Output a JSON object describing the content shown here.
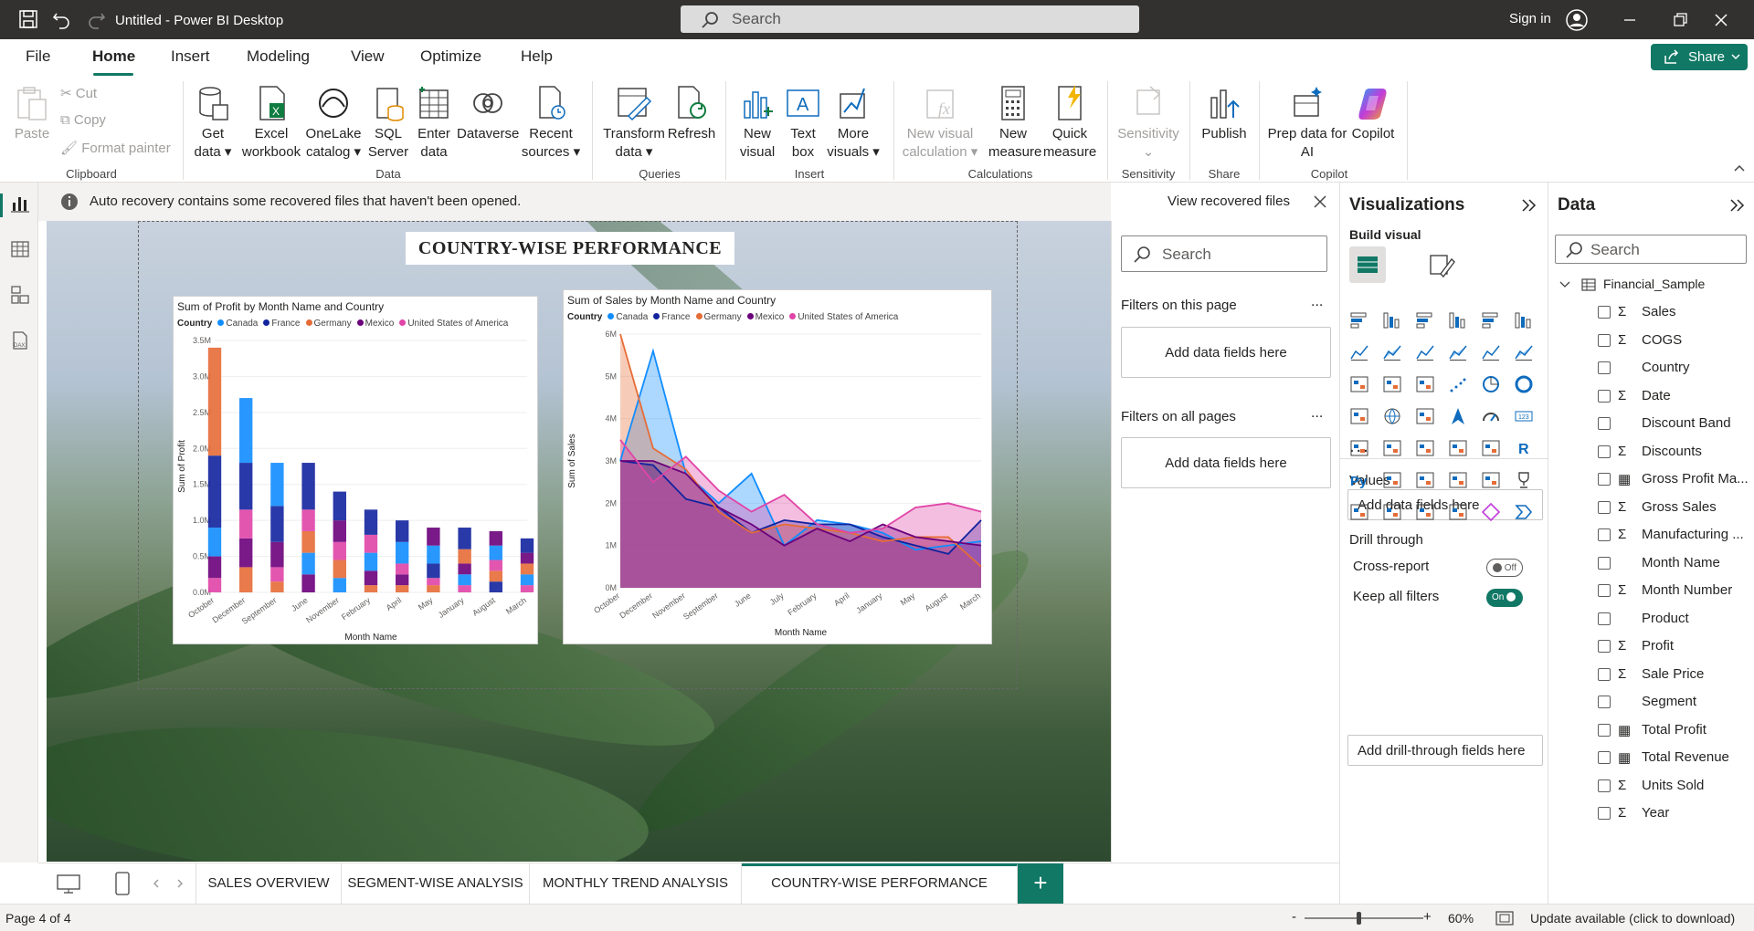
{
  "window": {
    "title": "Untitled - Power BI Desktop",
    "search_placeholder": "Search",
    "signin": "Sign in"
  },
  "menu": {
    "items": [
      "File",
      "Home",
      "Insert",
      "Modeling",
      "View",
      "Optimize",
      "Help"
    ],
    "active": "Home",
    "share": "Share"
  },
  "ribbon": {
    "clipboard": {
      "paste": "Paste",
      "cut": "Cut",
      "copy": "Copy",
      "format_painter": "Format painter",
      "group": "Clipboard"
    },
    "data": {
      "get_data": "Get data",
      "excel": "Excel workbook",
      "onelake": "OneLake catalog",
      "sql": "SQL Server",
      "enter": "Enter data",
      "dataverse": "Dataverse",
      "recent": "Recent sources",
      "group": "Data"
    },
    "queries": {
      "transform": "Transform data",
      "refresh": "Refresh",
      "group": "Queries"
    },
    "insert": {
      "new_visual": "New visual",
      "text_box": "Text box",
      "more": "More visuals",
      "group": "Insert"
    },
    "calculations": {
      "new_visual_calc": "New visual calculation",
      "new_measure": "New measure",
      "quick_measure": "Quick measure",
      "group": "Calculations"
    },
    "sensitivity": {
      "label": "Sensitivity",
      "group": "Sensitivity"
    },
    "share": {
      "publish": "Publish",
      "group": "Share"
    },
    "copilot": {
      "prep": "Prep data for AI",
      "copilot": "Copilot",
      "group": "Copilot"
    }
  },
  "notice": {
    "text": "Auto recovery contains some recovered files that haven't been opened.",
    "button": "View recovered files"
  },
  "report_title": "COUNTRY-WISE PERFORMANCE",
  "chart_data": [
    {
      "type": "area",
      "title": "Sum of Profit by Month Name and Country",
      "legend_title": "Country",
      "xlabel": "Month Name",
      "ylabel": "Sum of Profit",
      "ylim": [
        0,
        3500000
      ],
      "y_ticks": [
        "0.0M",
        "0.5M",
        "1.0M",
        "1.5M",
        "2.0M",
        "2.5M",
        "3.0M",
        "3.5M"
      ],
      "categories": [
        "October",
        "December",
        "September",
        "June",
        "November",
        "February",
        "April",
        "May",
        "January",
        "August",
        "March"
      ],
      "series": [
        {
          "name": "Canada",
          "color": "#118DFF",
          "values": [
            400000,
            900000,
            600000,
            300000,
            200000,
            250000,
            300000,
            250000,
            150000,
            200000,
            150000
          ]
        },
        {
          "name": "France",
          "color": "#12239E",
          "values": [
            1000000,
            650000,
            500000,
            650000,
            400000,
            350000,
            300000,
            200000,
            300000,
            150000,
            200000
          ]
        },
        {
          "name": "Germany",
          "color": "#E66C37",
          "values": [
            1500000,
            350000,
            150000,
            300000,
            250000,
            100000,
            100000,
            100000,
            200000,
            150000,
            150000
          ]
        },
        {
          "name": "Mexico",
          "color": "#6B007B",
          "values": [
            300000,
            400000,
            350000,
            250000,
            300000,
            200000,
            150000,
            250000,
            150000,
            200000,
            150000
          ]
        },
        {
          "name": "United States of America",
          "color": "#E044A7",
          "values": [
            200000,
            400000,
            200000,
            300000,
            250000,
            250000,
            150000,
            100000,
            100000,
            150000,
            100000
          ]
        }
      ]
    },
    {
      "type": "area",
      "title": "Sum of Sales by Month Name and Country",
      "legend_title": "Country",
      "xlabel": "Month Name",
      "ylabel": "Sum of Sales",
      "ylim": [
        0,
        6000000
      ],
      "y_ticks": [
        "0M",
        "1M",
        "2M",
        "3M",
        "4M",
        "5M",
        "6M"
      ],
      "categories": [
        "October",
        "December",
        "November",
        "September",
        "June",
        "July",
        "February",
        "April",
        "January",
        "May",
        "August",
        "March"
      ],
      "series": [
        {
          "name": "Canada",
          "color": "#118DFF",
          "values": [
            3000000,
            5600000,
            2700000,
            2000000,
            2700000,
            1000000,
            1600000,
            1500000,
            1300000,
            900000,
            1000000,
            1100000
          ]
        },
        {
          "name": "France",
          "color": "#12239E",
          "values": [
            3000000,
            2900000,
            2100000,
            1900000,
            1300000,
            1600000,
            1500000,
            1500000,
            1200000,
            1000000,
            800000,
            1600000
          ]
        },
        {
          "name": "Germany",
          "color": "#E66C37",
          "values": [
            6000000,
            3300000,
            2800000,
            1800000,
            1300000,
            1500000,
            1400000,
            1300000,
            1100000,
            1200000,
            1200000,
            500000
          ]
        },
        {
          "name": "Mexico",
          "color": "#6B007B",
          "values": [
            3000000,
            3000000,
            2700000,
            1900000,
            1500000,
            1000000,
            1400000,
            1100000,
            1500000,
            1200000,
            1100000,
            1000000
          ]
        },
        {
          "name": "United States of America",
          "color": "#E044A7",
          "values": [
            3500000,
            2500000,
            3100000,
            2300000,
            1800000,
            2200000,
            1500000,
            1300000,
            1400000,
            1900000,
            2000000,
            1800000
          ]
        }
      ]
    }
  ],
  "filters": {
    "search_placeholder": "Search",
    "on_page": "Filters on this page",
    "on_all": "Filters on all pages",
    "add": "Add data fields here",
    "more": "..."
  },
  "viz": {
    "title": "Visualizations",
    "build": "Build visual",
    "values": "Values",
    "add_fields": "Add data fields here",
    "drill": "Drill through",
    "cross": "Cross-report",
    "cross_state": "Off",
    "keep": "Keep all filters",
    "keep_state": "On",
    "drill_add": "Add drill-through fields here",
    "more": "..."
  },
  "datapane": {
    "title": "Data",
    "search_placeholder": "Search",
    "table": "Financial_Sample",
    "fields": [
      {
        "name": "Sales",
        "icon": "sigma"
      },
      {
        "name": "COGS",
        "icon": "sigma"
      },
      {
        "name": "Country",
        "icon": ""
      },
      {
        "name": "Date",
        "icon": "sigma"
      },
      {
        "name": "Discount Band",
        "icon": ""
      },
      {
        "name": "Discounts",
        "icon": "sigma"
      },
      {
        "name": "Gross Profit Ma...",
        "icon": "calc"
      },
      {
        "name": "Gross Sales",
        "icon": "sigma"
      },
      {
        "name": "Manufacturing ...",
        "icon": "sigma"
      },
      {
        "name": "Month Name",
        "icon": ""
      },
      {
        "name": "Month Number",
        "icon": "sigma"
      },
      {
        "name": "Product",
        "icon": ""
      },
      {
        "name": "Profit",
        "icon": "sigma"
      },
      {
        "name": "Sale Price",
        "icon": "sigma"
      },
      {
        "name": "Segment",
        "icon": ""
      },
      {
        "name": "Total Profit",
        "icon": "calc"
      },
      {
        "name": "Total Revenue",
        "icon": "calc"
      },
      {
        "name": "Units Sold",
        "icon": "sigma"
      },
      {
        "name": "Year",
        "icon": "sigma"
      }
    ]
  },
  "tabs": {
    "items": [
      "SALES OVERVIEW",
      "SEGMENT-WISE ANALYSIS",
      "MONTHLY TREND ANALYSIS",
      "COUNTRY-WISE PERFORMANCE"
    ],
    "active": 3,
    "add": "+"
  },
  "status": {
    "page": "Page 4 of 4",
    "zoom_minus": "-",
    "zoom_plus": "+",
    "zoom": "60%",
    "zoom_fraction": 0.6,
    "update": "Update available (click to download)"
  }
}
